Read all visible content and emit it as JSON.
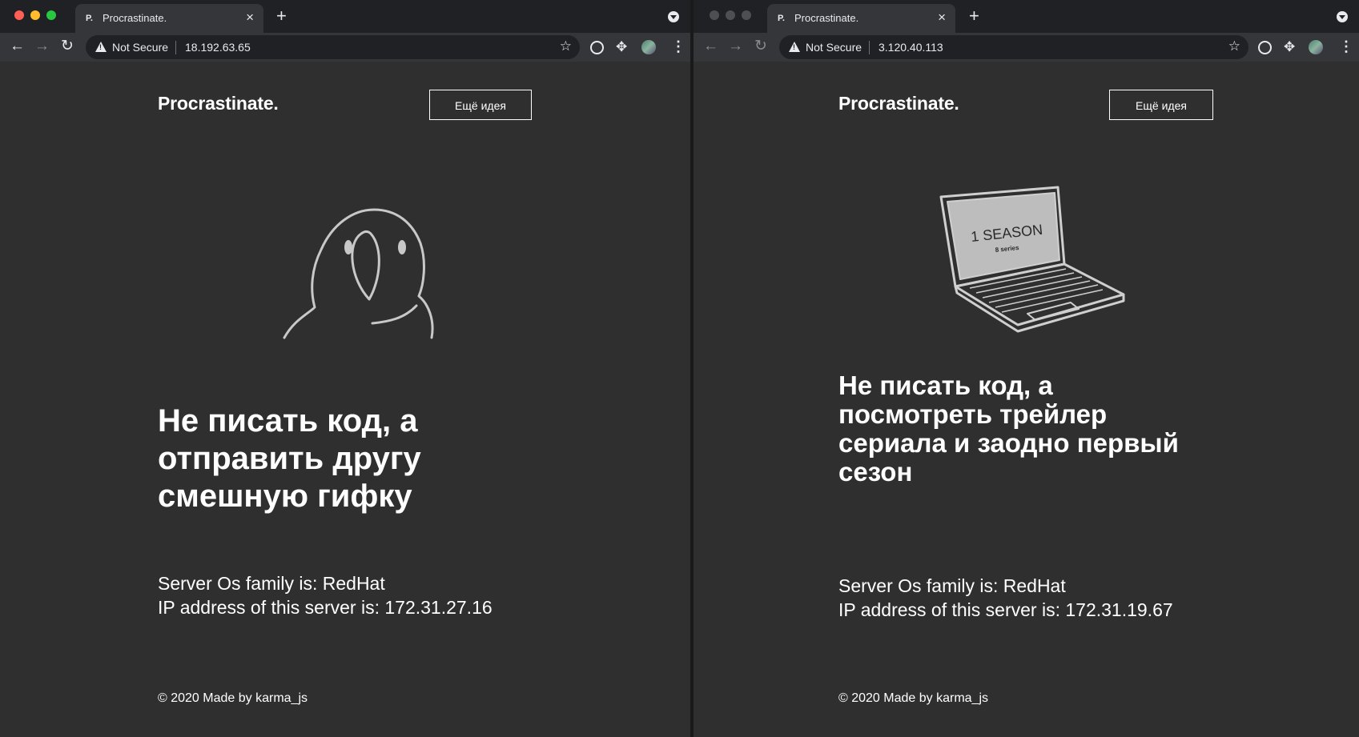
{
  "windows": [
    {
      "tab": {
        "favicon": "P.",
        "title": "Procrastinate."
      },
      "address": {
        "security": "Not Secure",
        "url": "18.192.63.65"
      },
      "page": {
        "logo": "Procrastinate.",
        "button": "Ещё идея",
        "illustration": "parrot",
        "headline_lines": [
          "Не писать код, а",
          "отправить другу",
          "смешную гифку"
        ],
        "info_lines": [
          "Server Os family is: RedHat",
          "IP address of this server is: 172.31.27.16"
        ],
        "footer": "© 2020 Made by karma_js"
      }
    },
    {
      "tab": {
        "favicon": "P.",
        "title": "Procrastinate."
      },
      "address": {
        "security": "Not Secure",
        "url": "3.120.40.113"
      },
      "page": {
        "logo": "Procrastinate.",
        "button": "Ещё идея",
        "illustration": "laptop",
        "illustration_text": {
          "title": "1 SEASON",
          "subtitle": "8 series"
        },
        "headline_lines": [
          "Не писать код, а",
          "посмотреть трейлер",
          "сериала и заодно первый",
          "сезон"
        ],
        "info_lines": [
          "Server Os family is: RedHat",
          "IP address of this server is: 172.31.19.67"
        ],
        "footer": "© 2020 Made by karma_js"
      }
    }
  ],
  "icons": {
    "back": "arrow-left-icon",
    "forward": "arrow-right-icon",
    "reload": "reload-icon",
    "warning": "warning-triangle-icon",
    "bookmark": "star-icon",
    "tab_close": "close-icon",
    "new_tab": "plus-icon"
  },
  "colors": {
    "page_background": "#2f2f2f",
    "tabbar": "#202124",
    "toolbar": "#35363a",
    "text": "#ffffff",
    "traffic_close": "#ff5f57",
    "traffic_minimize": "#febc2e",
    "traffic_zoom": "#28c840"
  }
}
